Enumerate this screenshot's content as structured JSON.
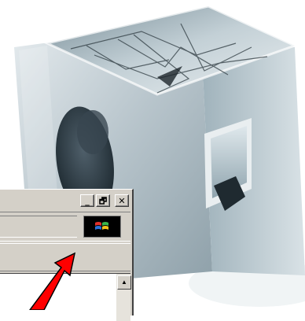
{
  "window": {
    "minimize_glyph": "_",
    "restore_glyph": "🗗",
    "close_glyph": "✕"
  },
  "scrollbar": {
    "up_glyph": "▲"
  },
  "colors": {
    "accent_arrow": "#ff0000",
    "window_face": "#d4d0c8"
  },
  "icons": [
    "cube-image",
    "minimize-icon",
    "restore-icon",
    "close-icon",
    "windows-logo-icon",
    "scroll-up-icon",
    "red-arrow-icon"
  ]
}
